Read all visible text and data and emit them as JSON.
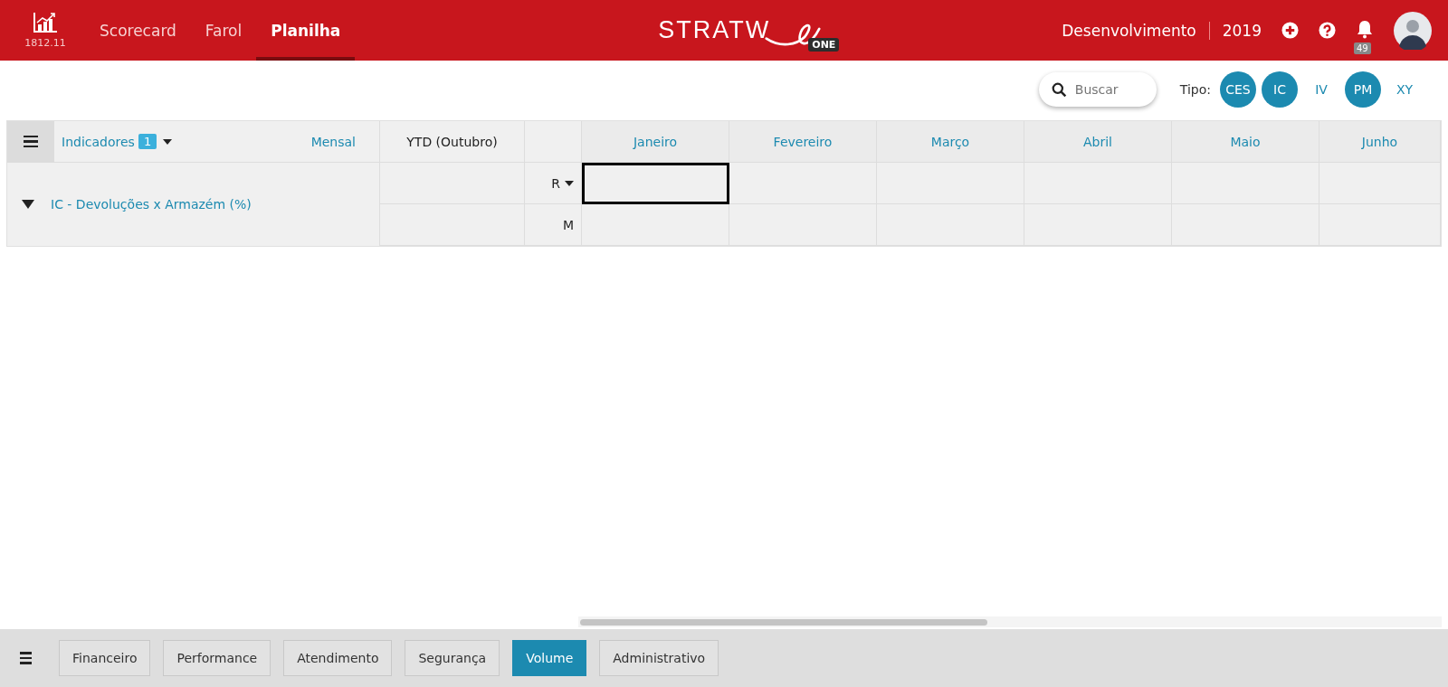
{
  "header": {
    "version": "1812.11",
    "nav": [
      {
        "label": "Scorecard",
        "selected": false
      },
      {
        "label": "Farol",
        "selected": false
      },
      {
        "label": "Planilha",
        "selected": true
      }
    ],
    "logo": {
      "text": "STRATW",
      "badge": "ONE"
    },
    "environment": "Desenvolvimento",
    "year": "2019",
    "notifications": "49"
  },
  "toolbar": {
    "search": {
      "placeholder": "Buscar"
    },
    "type_label": "Tipo:",
    "types": [
      {
        "label": "CES",
        "selected": true
      },
      {
        "label": "IC",
        "selected": true
      },
      {
        "label": "IV",
        "selected": false
      },
      {
        "label": "PM",
        "selected": true
      },
      {
        "label": "XY",
        "selected": false
      }
    ]
  },
  "table": {
    "indicators_label": "Indicadores",
    "indicators_count": "1",
    "period": "Mensal",
    "ytd": "YTD (Outubro)",
    "months": [
      "Janeiro",
      "Fevereiro",
      "Março",
      "Abril",
      "Maio",
      "Junho"
    ],
    "indicator": {
      "name": "IC - Devoluções x Armazém (%)",
      "expanded": true
    },
    "rows": [
      {
        "label": "R",
        "dropdown": true,
        "cells": [
          {
            "selected": true
          },
          {
            "selected": false
          },
          {
            "selected": false
          },
          {
            "selected": false
          },
          {
            "selected": false
          },
          {
            "selected": false
          }
        ]
      },
      {
        "label": "M",
        "dropdown": false,
        "cells": [
          {
            "selected": false
          },
          {
            "selected": false
          },
          {
            "selected": false
          },
          {
            "selected": false
          },
          {
            "selected": false
          },
          {
            "selected": false
          }
        ]
      }
    ]
  },
  "bottom_tabs": [
    {
      "label": "Financeiro",
      "selected": false
    },
    {
      "label": "Performance",
      "selected": false
    },
    {
      "label": "Atendimento",
      "selected": false
    },
    {
      "label": "Segurança",
      "selected": false
    },
    {
      "label": "Volume",
      "selected": true
    },
    {
      "label": "Administrativo",
      "selected": false
    }
  ]
}
